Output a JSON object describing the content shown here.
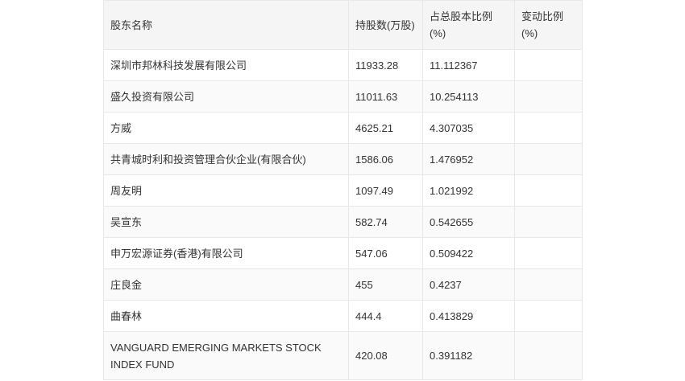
{
  "table": {
    "headers": [
      "股东名称",
      "持股数(万股)",
      "占总股本比例(%)",
      "变动比例(%)"
    ],
    "rows": [
      [
        "深圳市邦林科技发展有限公司",
        "11933.28",
        "11.112367",
        ""
      ],
      [
        "盛久投资有限公司",
        "11011.63",
        "10.254113",
        ""
      ],
      [
        "方威",
        "4625.21",
        "4.307035",
        ""
      ],
      [
        "共青城时利和投资管理合伙企业(有限合伙)",
        "1586.06",
        "1.476952",
        ""
      ],
      [
        "周友明",
        "1097.49",
        "1.021992",
        ""
      ],
      [
        "吴宣东",
        "582.74",
        "0.542655",
        ""
      ],
      [
        "申万宏源证券(香港)有限公司",
        "547.06",
        "0.509422",
        ""
      ],
      [
        "庄良金",
        "455",
        "0.4237",
        ""
      ],
      [
        "曲春林",
        "444.4",
        "0.413829",
        ""
      ],
      [
        "VANGUARD EMERGING MARKETS STOCK INDEX FUND",
        "420.08",
        "0.391182",
        ""
      ]
    ]
  }
}
